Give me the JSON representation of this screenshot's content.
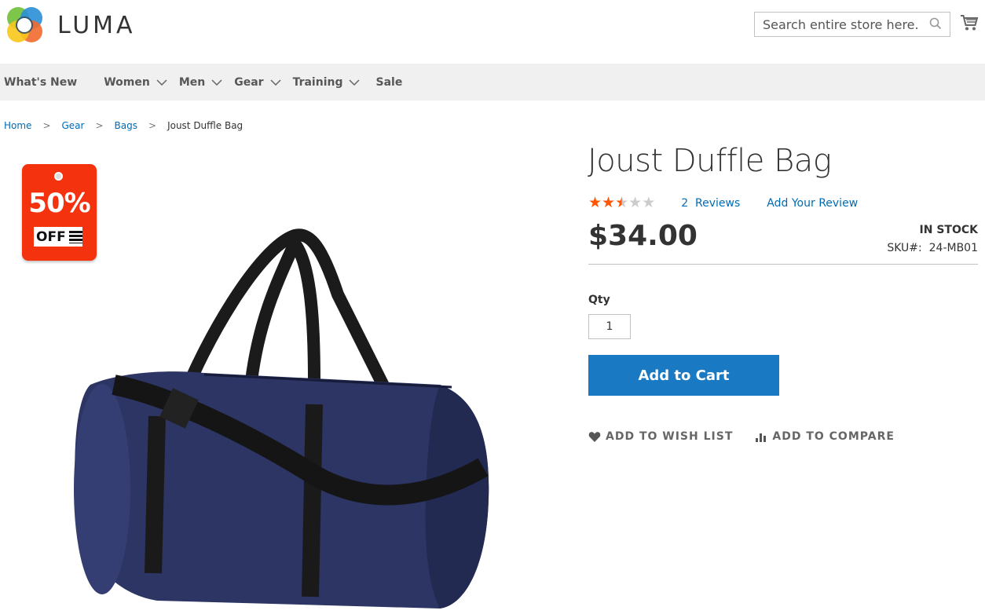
{
  "header": {
    "logo_text": "LUMA",
    "search_placeholder": "Search entire store here...",
    "cart_icon": "cart-icon",
    "search_icon": "search-icon"
  },
  "nav": {
    "items": [
      {
        "label": "What's New",
        "has_dropdown": false
      },
      {
        "label": "Women",
        "has_dropdown": true
      },
      {
        "label": "Men",
        "has_dropdown": true
      },
      {
        "label": "Gear",
        "has_dropdown": true
      },
      {
        "label": "Training",
        "has_dropdown": true
      },
      {
        "label": "Sale",
        "has_dropdown": false
      }
    ]
  },
  "breadcrumbs": {
    "items": [
      "Home",
      "Gear",
      "Bags"
    ],
    "current": "Joust Duffle Bag",
    "separator": ">"
  },
  "badge": {
    "percent": "50%",
    "off": "OFF"
  },
  "product": {
    "title": "Joust Duffle Bag",
    "rating_stars": 2.5,
    "rating_max": 5,
    "reviews_label": "2  Reviews",
    "add_review_label": "Add Your Review",
    "price": "$34.00",
    "stock": "IN STOCK",
    "sku_label": "SKU#:",
    "sku_value": "24-MB01",
    "qty_label": "Qty",
    "qty_value": "1",
    "add_to_cart": "Add to Cart",
    "wishlist": "ADD TO WISH LIST",
    "compare": "ADD TO COMPARE"
  },
  "colors": {
    "primary": "#1979c3",
    "link": "#006bb4",
    "star": "#ff5501",
    "badge": "#f4330e",
    "nav_bg": "#f0f0f0"
  }
}
